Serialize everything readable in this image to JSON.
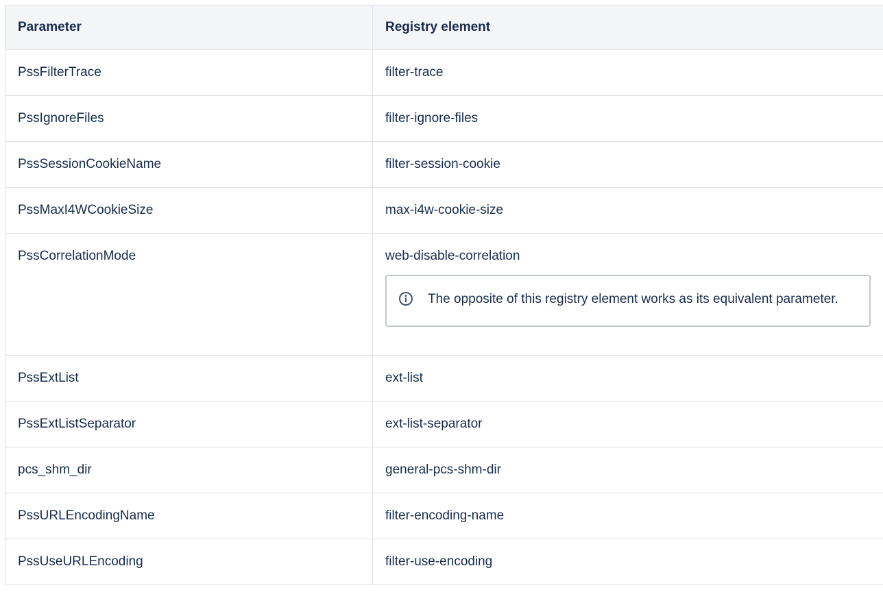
{
  "table": {
    "headers": [
      "Parameter",
      "Registry element"
    ],
    "rows": [
      {
        "parameter": "PssFilterTrace",
        "registry": "filter-trace"
      },
      {
        "parameter": "PssIgnoreFiles",
        "registry": "filter-ignore-files"
      },
      {
        "parameter": "PssSessionCookieName",
        "registry": "filter-session-cookie"
      },
      {
        "parameter": "PssMaxI4WCookieSize",
        "registry": "max-i4w-cookie-size"
      },
      {
        "parameter": "PssCorrelationMode",
        "registry": "web-disable-correlation",
        "note": "The opposite of this registry element works as its equivalent parameter."
      },
      {
        "parameter": "PssExtList",
        "registry": "ext-list"
      },
      {
        "parameter": "PssExtListSeparator",
        "registry": "ext-list-separator"
      },
      {
        "parameter": "pcs_shm_dir",
        "registry": "general-pcs-shm-dir"
      },
      {
        "parameter": "PssURLEncodingName",
        "registry": "filter-encoding-name"
      },
      {
        "parameter": "PssUseURLEncoding",
        "registry": "filter-use-encoding"
      }
    ]
  },
  "colors": {
    "text": "#172b4d",
    "header_bg": "#f4f5f7",
    "border": "#dfe1e6",
    "note_border": "#c1c7d0",
    "info_icon": "#42526e"
  },
  "icons": {
    "note": "info-circle-icon"
  }
}
